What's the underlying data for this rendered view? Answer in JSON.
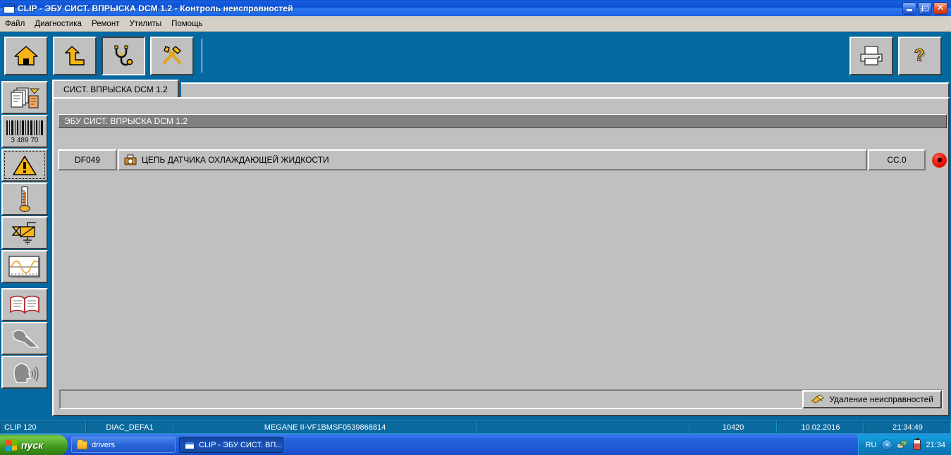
{
  "window": {
    "title": "CLIP - ЭБУ СИСТ. ВПРЫСКА DCM 1.2 - Контроль неисправностей",
    "icon": "clip-app-icon",
    "controls": {
      "minimize": "minimize",
      "restore": "restore",
      "close": "close"
    }
  },
  "menu": {
    "items": [
      {
        "label": "Файл",
        "name": "menu-file"
      },
      {
        "label": "Диагностика",
        "name": "menu-diagnostics"
      },
      {
        "label": "Ремонт",
        "name": "menu-repair"
      },
      {
        "label": "Утилиты",
        "name": "menu-utilities"
      },
      {
        "label": "Помощь",
        "name": "menu-help"
      }
    ]
  },
  "toolbar": {
    "left": [
      {
        "icon": "home-icon",
        "pressed": false
      },
      {
        "icon": "up-arrow-icon",
        "pressed": false
      },
      {
        "icon": "stethoscope-icon",
        "pressed": true
      },
      {
        "icon": "tools-icon",
        "pressed": false
      }
    ],
    "right": [
      {
        "icon": "printer-icon",
        "pressed": false
      },
      {
        "icon": "help-question-icon",
        "pressed": false
      }
    ]
  },
  "sidebar": {
    "items": [
      {
        "icon": "documents-icon",
        "focused": false
      },
      {
        "icon": "barcode-icon",
        "focused": false,
        "barcode_text": "3 489 70"
      },
      {
        "icon": "warning-triangle-icon",
        "focused": true
      },
      {
        "icon": "thermometer-icon",
        "focused": false
      },
      {
        "icon": "actuator-icon",
        "focused": false
      },
      {
        "icon": "waveform-graph-icon",
        "focused": false
      },
      {
        "icon": "book-icon",
        "focused": false
      },
      {
        "icon": "person-seated-icon",
        "focused": false
      },
      {
        "icon": "speaking-head-icon",
        "focused": false
      }
    ]
  },
  "main": {
    "tab": {
      "label": "СИСТ. ВПРЫСКА DCM 1.2"
    },
    "ecu_header": "ЭБУ СИСТ. ВПРЫСКА DCM 1.2",
    "fault_table": {
      "rows": [
        {
          "code": "DF049",
          "icon": "sensor-icon",
          "description": "ЦЕПЬ ДАТЧИКА ОХЛАЖДАЮЩЕЙ ЖИДКОСТИ",
          "status": "CC.0",
          "led_color": "#ee1c10"
        }
      ]
    },
    "clear_button": {
      "label": "Удаление неисправностей",
      "icon": "eraser-icon"
    }
  },
  "statusbar": {
    "cells": [
      {
        "text": "CLIP 120",
        "name": "status-clip-version"
      },
      {
        "text": "DIAC_DEFA1",
        "name": "status-diac-code"
      },
      {
        "text": "MEGANE II-VF1BMSF0539868814",
        "name": "status-vehicle-vin"
      },
      {
        "text": "",
        "name": "status-empty"
      },
      {
        "text": "10420",
        "name": "status-counter"
      },
      {
        "text": "10.02.2016",
        "name": "status-date"
      },
      {
        "text": "21:34:49",
        "name": "status-time"
      }
    ]
  },
  "taskbar": {
    "start_label": "пуск",
    "buttons": [
      {
        "label": "drivers",
        "icon": "folder-icon",
        "active": false
      },
      {
        "label": "CLIP - ЭБУ СИСТ. ВП...",
        "icon": "clip-app-icon",
        "active": true
      }
    ],
    "tray": {
      "language": "RU",
      "chevron": "«",
      "icons": [
        "network-icon",
        "battery-icon"
      ],
      "clock": "21:34"
    }
  },
  "colors": {
    "app_background": "#0668a0",
    "panel_face": "#c0c0c0",
    "header_gray": "#808080",
    "led_red": "#ee1c10",
    "titlebar_blue": "#0a51d6"
  }
}
